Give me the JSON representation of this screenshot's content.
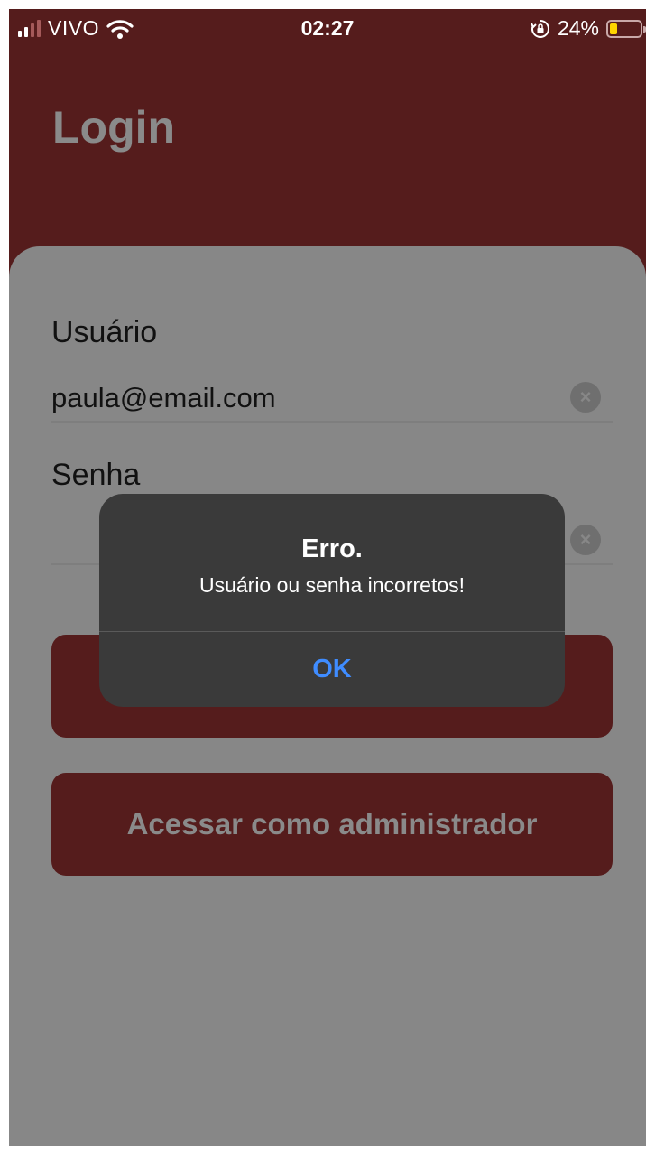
{
  "status_bar": {
    "carrier": "VIVO",
    "time": "02:27",
    "battery_percent": "24%",
    "battery_level": 0.24,
    "signal_bars": 2,
    "icons": [
      "signal-icon",
      "wifi-icon",
      "rotation-lock-icon",
      "battery-icon"
    ]
  },
  "header": {
    "title": "Login"
  },
  "form": {
    "user_label": "Usuário",
    "user_value": "paula@email.com",
    "password_label": "Senha",
    "password_value": "",
    "clear_icon": "×",
    "admin_button_label": "Acessar como administrador"
  },
  "alert": {
    "title": "Erro.",
    "message": "Usuário ou senha incorretos!",
    "ok_label": "OK"
  },
  "colors": {
    "header_bg": "#551c1c",
    "overlay_card": "#878787",
    "alert_bg": "#3a3a3a",
    "alert_button": "#3f8cff",
    "battery": "#ffd400"
  }
}
